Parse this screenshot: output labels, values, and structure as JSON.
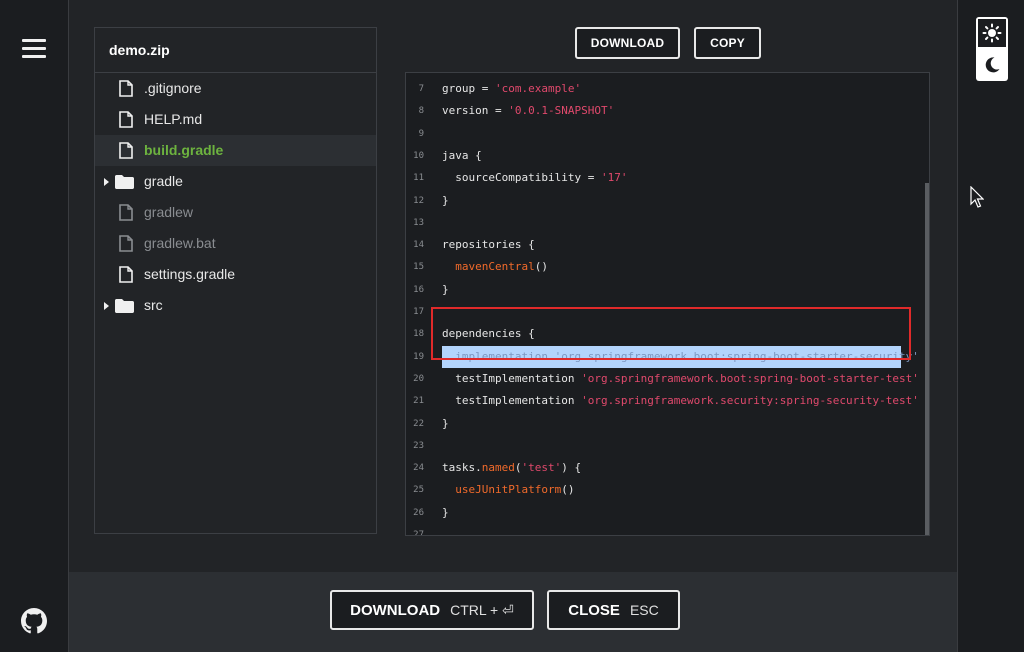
{
  "sidebar": {
    "menu_icon": "hamburger-icon",
    "github_icon": "github-icon"
  },
  "theme": {
    "light_icon": "sun-icon",
    "dark_icon": "moon-icon"
  },
  "explorer": {
    "title": "demo.zip",
    "items": [
      {
        "label": ".gitignore",
        "type": "file"
      },
      {
        "label": "HELP.md",
        "type": "file"
      },
      {
        "label": "build.gradle",
        "type": "file",
        "selected": true
      },
      {
        "label": "gradle",
        "type": "folder"
      },
      {
        "label": "gradlew",
        "type": "file",
        "dim": true
      },
      {
        "label": "gradlew.bat",
        "type": "file",
        "dim": true
      },
      {
        "label": "settings.gradle",
        "type": "file"
      },
      {
        "label": "src",
        "type": "folder"
      }
    ]
  },
  "toolbar": {
    "download_label": "DOWNLOAD",
    "copy_label": "COPY"
  },
  "code": {
    "lines": [
      {
        "n": "7",
        "text": "group = ",
        "str": "'com.example'"
      },
      {
        "n": "8",
        "text": "version = ",
        "str": "'0.0.1-SNAPSHOT'"
      },
      {
        "n": "9",
        "text": ""
      },
      {
        "n": "10",
        "text": "java {"
      },
      {
        "n": "11",
        "text": "  sourceCompatibility = ",
        "str": "'17'"
      },
      {
        "n": "12",
        "text": "}"
      },
      {
        "n": "13",
        "text": ""
      },
      {
        "n": "14",
        "text": "repositories {"
      },
      {
        "n": "15",
        "fn": "  mavenCentral",
        "text2": "()"
      },
      {
        "n": "16",
        "text": "}"
      },
      {
        "n": "17",
        "text": ""
      },
      {
        "n": "18",
        "text": "dependencies {"
      },
      {
        "n": "19",
        "text": "  implementation ",
        "str": "'org.springframework.boot:spring-boot-starter-security'"
      },
      {
        "n": "20",
        "text": "  testImplementation ",
        "str": "'org.springframework.boot:spring-boot-starter-test'"
      },
      {
        "n": "21",
        "text": "  testImplementation ",
        "str": "'org.springframework.security:spring-security-test'"
      },
      {
        "n": "22",
        "text": "}"
      },
      {
        "n": "23",
        "text": ""
      },
      {
        "n": "24",
        "text": "tasks.",
        "fn": "named",
        "text2": "(",
        "str": "'test'",
        "text3": ") {"
      },
      {
        "n": "25",
        "fn": "  useJUnitPlatform",
        "text2": "()"
      },
      {
        "n": "26",
        "text": "}"
      },
      {
        "n": "27",
        "text": ""
      }
    ]
  },
  "footer": {
    "download_label": "DOWNLOAD",
    "download_shortcut": "CTRL + ⏎",
    "close_label": "CLOSE",
    "close_shortcut": "ESC"
  }
}
